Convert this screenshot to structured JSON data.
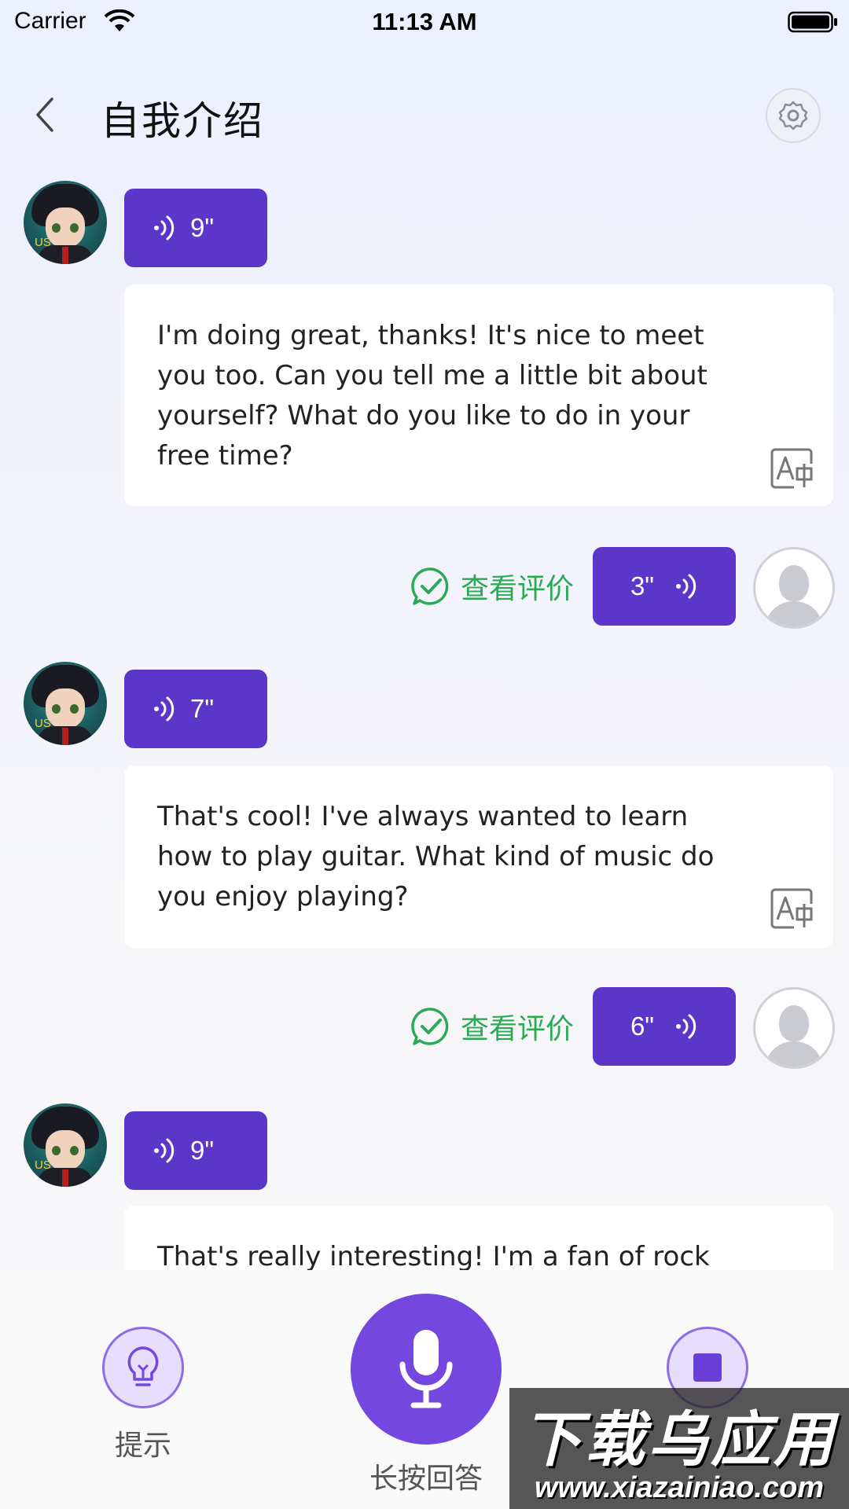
{
  "status_bar": {
    "carrier": "Carrier",
    "time": "11:13 AM"
  },
  "header": {
    "title": "自我介绍",
    "back_icon": "chevron-left-icon",
    "settings_icon": "gear-icon"
  },
  "messages": [
    {
      "role": "bot",
      "avatar_badge": "US",
      "duration": "9\"",
      "text": " I'm doing great, thanks! It's nice to meet you too. Can you tell me a little bit about yourself? What do you like to do in your free time?"
    },
    {
      "role": "user",
      "duration": "3\"",
      "evaluate_label": "查看评价"
    },
    {
      "role": "bot",
      "avatar_badge": "US",
      "duration": "7\"",
      "text": " That's cool! I've always wanted to learn how to play guitar. What kind of music do you enjoy playing?"
    },
    {
      "role": "user",
      "duration": "6\"",
      "evaluate_label": "查看评价"
    },
    {
      "role": "bot",
      "avatar_badge": "US",
      "duration": "9\"",
      "text": " That's really interesting! I'm a fan of rock"
    }
  ],
  "bottom_bar": {
    "hint_label": "提示",
    "record_label": "长按回答",
    "hint_icon": "lightbulb-icon",
    "record_icon": "microphone-icon",
    "stop_icon": "stop-icon"
  },
  "watermark": {
    "title": "下载乌应用",
    "url": "www.xiazainiao.com"
  },
  "colors": {
    "accent": "#5B36C9",
    "success": "#2BAA55",
    "background": "#F2F3FC"
  }
}
